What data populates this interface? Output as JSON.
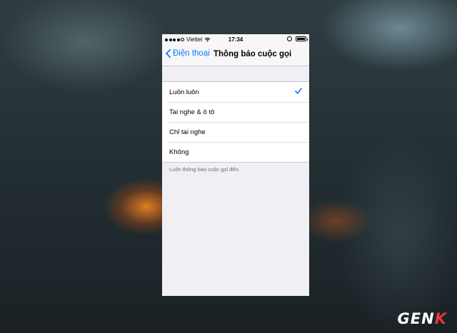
{
  "status_bar": {
    "carrier": "Viettel",
    "time": "17:34",
    "signal_bars_filled": 4,
    "signal_bars_total": 5
  },
  "nav": {
    "back_label": "Điện thoại",
    "title": "Thông báo cuộc gọi"
  },
  "options": [
    {
      "label": "Luôn luôn",
      "selected": true
    },
    {
      "label": "Tai nghe & ô tô",
      "selected": false
    },
    {
      "label": "Chỉ tai nghe",
      "selected": false
    },
    {
      "label": "Không",
      "selected": false
    }
  ],
  "footer_note": "Luôn thông báo cuộc gọi đến.",
  "watermark": {
    "main": "GEN",
    "accent": "K"
  },
  "colors": {
    "ios_blue": "#0a7aff",
    "watermark_accent": "#e53935"
  },
  "icons": [
    "wifi-icon",
    "orientation-lock-icon",
    "battery-icon",
    "back-chevron-icon",
    "checkmark-icon"
  ]
}
